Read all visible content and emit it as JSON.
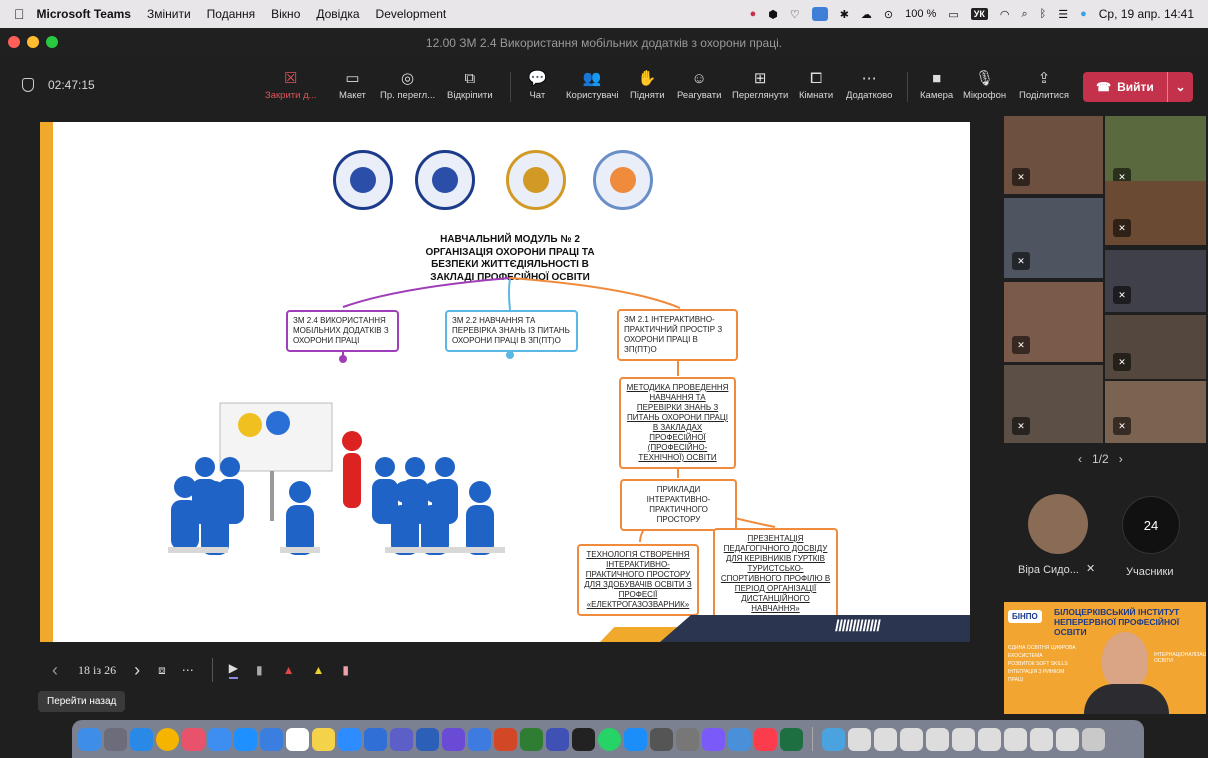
{
  "menubar": {
    "app": "Microsoft Teams",
    "items": [
      "Змінити",
      "Подання",
      "Вікно",
      "Довідка",
      "Development"
    ],
    "battery": "100 %",
    "keyboard": "УК",
    "datetime": "Ср, 19 апр.  14:41"
  },
  "window": {
    "title": "12.00 ЗМ 2.4 Використання мобільних додатків з охорони праці."
  },
  "toolbar": {
    "timer": "02:47:15",
    "buttons": [
      {
        "name": "close-button",
        "label": "Закрити д...",
        "icon": "☒"
      },
      {
        "name": "layout-button",
        "label": "Макет",
        "icon": "▭"
      },
      {
        "name": "preview-button",
        "label": "Пр. перегл...",
        "icon": "◎"
      },
      {
        "name": "popout-button",
        "label": "Відкріпити",
        "icon": "⧉"
      },
      {
        "name": "chat-button",
        "label": "Чат",
        "icon": "💬"
      },
      {
        "name": "users-button",
        "label": "Користувачі",
        "icon": "👥"
      },
      {
        "name": "raise-button",
        "label": "Підняти",
        "icon": "✋"
      },
      {
        "name": "react-button",
        "label": "Реагувати",
        "icon": "☺"
      },
      {
        "name": "view-button",
        "label": "Переглянути",
        "icon": "⊞"
      },
      {
        "name": "rooms-button",
        "label": "Кімнати",
        "icon": "⧠"
      },
      {
        "name": "more-button",
        "label": "Додатково",
        "icon": "⋯"
      },
      {
        "name": "camera-button",
        "label": "Камера",
        "icon": "■"
      },
      {
        "name": "mic-button",
        "label": "Мікрофон",
        "icon": "🎙"
      },
      {
        "name": "share-button",
        "label": "Поділитися",
        "icon": "⇪"
      }
    ],
    "leave": "Вийти"
  },
  "slide": {
    "title": "НАВЧАЛЬНИЙ МОДУЛЬ № 2 ОРГАНІЗАЦІЯ ОХОРОНИ ПРАЦІ ТА БЕЗПЕКИ ЖИТТЄДІЯЛЬНОСТІ В ЗАКЛАДІ ПРОФЕСІЙНОЇ ОСВІТИ",
    "boxes": {
      "b24": "ЗМ 2.4 ВИКОРИСТАННЯ МОБІЛЬНИХ ДОДАТКІВ З ОХОРОНИ ПРАЦІ",
      "b22": "ЗМ 2.2 НАВЧАННЯ ТА ПЕРЕВІРКА ЗНАНЬ ІЗ ПИТАНЬ ОХОРОНИ ПРАЦІ В ЗП(ПТ)О",
      "b21": "ЗМ 2.1 ІНТЕРАКТИВНО-ПРАКТИЧНИЙ ПРОСТІР З ОХОРОНИ ПРАЦІ В ЗП(ПТ)О",
      "method": "МЕТОДИКА ПРОВЕДЕННЯ НАВЧАННЯ ТА ПЕРЕВІРКИ ЗНАНЬ З ПИТАНЬ ОХОРОНИ ПРАЦІ В ЗАКЛАДАХ ПРОФЕСІЙНОЇ (ПРОФЕСІЙНО-ТЕХНІЧНОЇ) ОСВІТИ",
      "examples": "ПРИКЛАДИ ІНТЕРАКТИВНО-ПРАКТИЧНОГО ПРОСТОРУ",
      "tech": "ТЕХНОЛОГІЯ СТВОРЕННЯ ІНТЕРАКТИВНО-ПРАКТИЧНОГО ПРОСТОРУ ДЛЯ ЗДОБУВАЧІВ ОСВІТИ З ПРОФЕСІЇ «ЕЛЕКТРОГАЗОЗВАРНИК»",
      "present": "ПРЕЗЕНТАЦІЯ ПЕДАГОГІЧНОГО ДОСВІДУ ДЛЯ КЕРІВНИКІВ ГУРТКІВ ТУРИСТСЬКО-СПОРТИВНОГО ПРОФІЛЮ В ПЕРІОД ОРГАНІЗАЦІЇ ДИСТАНЦІЙНОГО НАВЧАННЯ»"
    },
    "stripes": "/////////////"
  },
  "controls": {
    "page": "18 із 26",
    "tooltip": "Перейти назад"
  },
  "participants": {
    "pager": "1/2",
    "person": "Віра Сидо...",
    "count": "24",
    "count_label": "Учасники"
  },
  "thumb": {
    "logo": "БІНПО",
    "title": "БІЛОЦЕРКІВСЬКИЙ ІНСТИТУТ НЕПЕРЕРВНОЇ ПРОФЕСІЙНОЇ ОСВІТИ",
    "items": [
      "ЄДИНА ОСВІТНЯ ЦИФРОВА ЕКОСИСТЕМА",
      "РОЗВИТОК SOFT SKILLS",
      "ІНТЕГРАЦІЯ З РИНКОМ ПРАЦІ",
      "ІНТЕРНАЦІОНАЛІЗАЦІЯ ОСВІТИ"
    ]
  },
  "colors": {
    "purple": "#a03db8",
    "blue": "#5bb7e3",
    "orange": "#f08a3c",
    "leave": "#c4314b"
  }
}
